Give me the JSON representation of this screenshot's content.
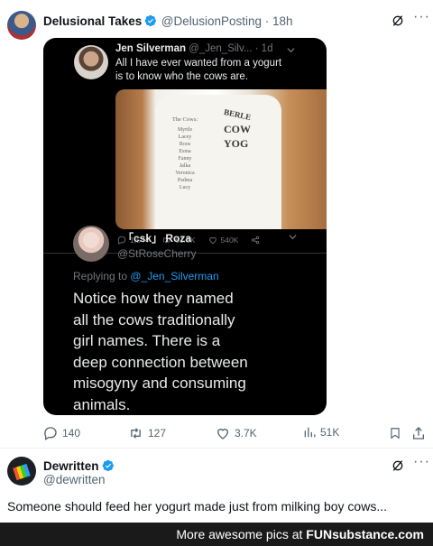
{
  "tweet": {
    "author_name": "Delusional Takes",
    "handle": "@DelusionPosting",
    "time": "18h",
    "stats": {
      "replies": "140",
      "retweets": "127",
      "likes": "3.7K",
      "views": "51K"
    }
  },
  "embedded_tweet": {
    "author_name": "Jen Silverman",
    "handle_time": "@_Jen_Silv... · 1d",
    "text_line1": "All I have ever wanted from a yogurt",
    "text_line2": "is to know who the cows are.",
    "photo": {
      "cup_heading": "The Cows:",
      "cow_names": [
        "Myrtle",
        "Lacey",
        "Roos",
        "Esma",
        "Fanny",
        "Jalka",
        "Veronica",
        "Padma",
        "Lucy"
      ],
      "brand_lines": [
        "BERLE",
        "COW",
        "YOG"
      ]
    },
    "stats": {
      "replies": "1,544",
      "retweets": "61.5K",
      "likes": "540K"
    }
  },
  "embedded_reply": {
    "author_name": "「csk」 Roza",
    "handle": "@StRoseCherry",
    "replying_to_prefix": "Replying to",
    "replying_to_handle": "@_Jen_Silverman",
    "text_lines": [
      "Notice how they named",
      "all the cows traditionally",
      "girl names. There is a",
      "deep connection between",
      "misogyny and consuming",
      "animals."
    ]
  },
  "reply": {
    "author_name": "Dewritten",
    "handle": "@dewritten",
    "text": "Someone should feed her yogurt made just from milking boy cows..."
  },
  "footer": {
    "prefix": "More awesome pics at ",
    "brand": "FUNsubstance.com"
  },
  "colors": {
    "accent": "#1d9bf0",
    "muted": "#536471",
    "dark_bg": "#000000"
  }
}
